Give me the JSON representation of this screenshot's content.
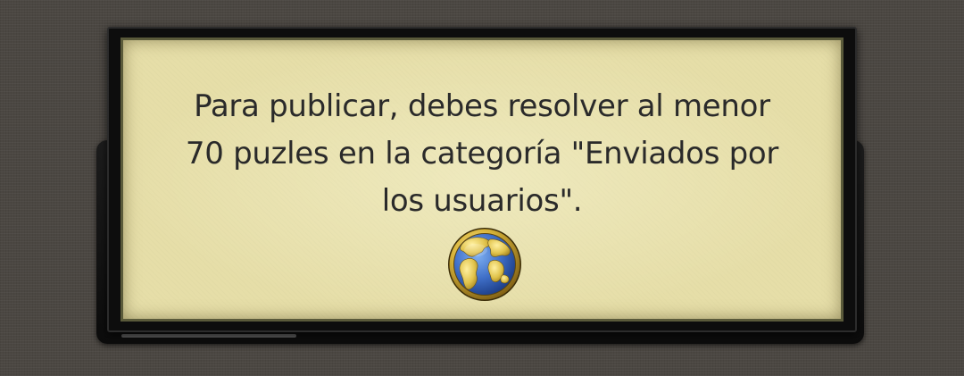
{
  "dialog": {
    "lines": [
      "Para publicar, debes resolver al menor",
      "70 puzles en la categoría \"Enviados por",
      "los usuarios\"."
    ],
    "icon": "globe-icon"
  },
  "colors": {
    "background": "#4b4742",
    "frame": "#0d0d0d",
    "paper": "#e6dea8",
    "text": "#2a2a2a",
    "globe_ocean": "#3f6fc8",
    "globe_land": "#e0c24a"
  }
}
